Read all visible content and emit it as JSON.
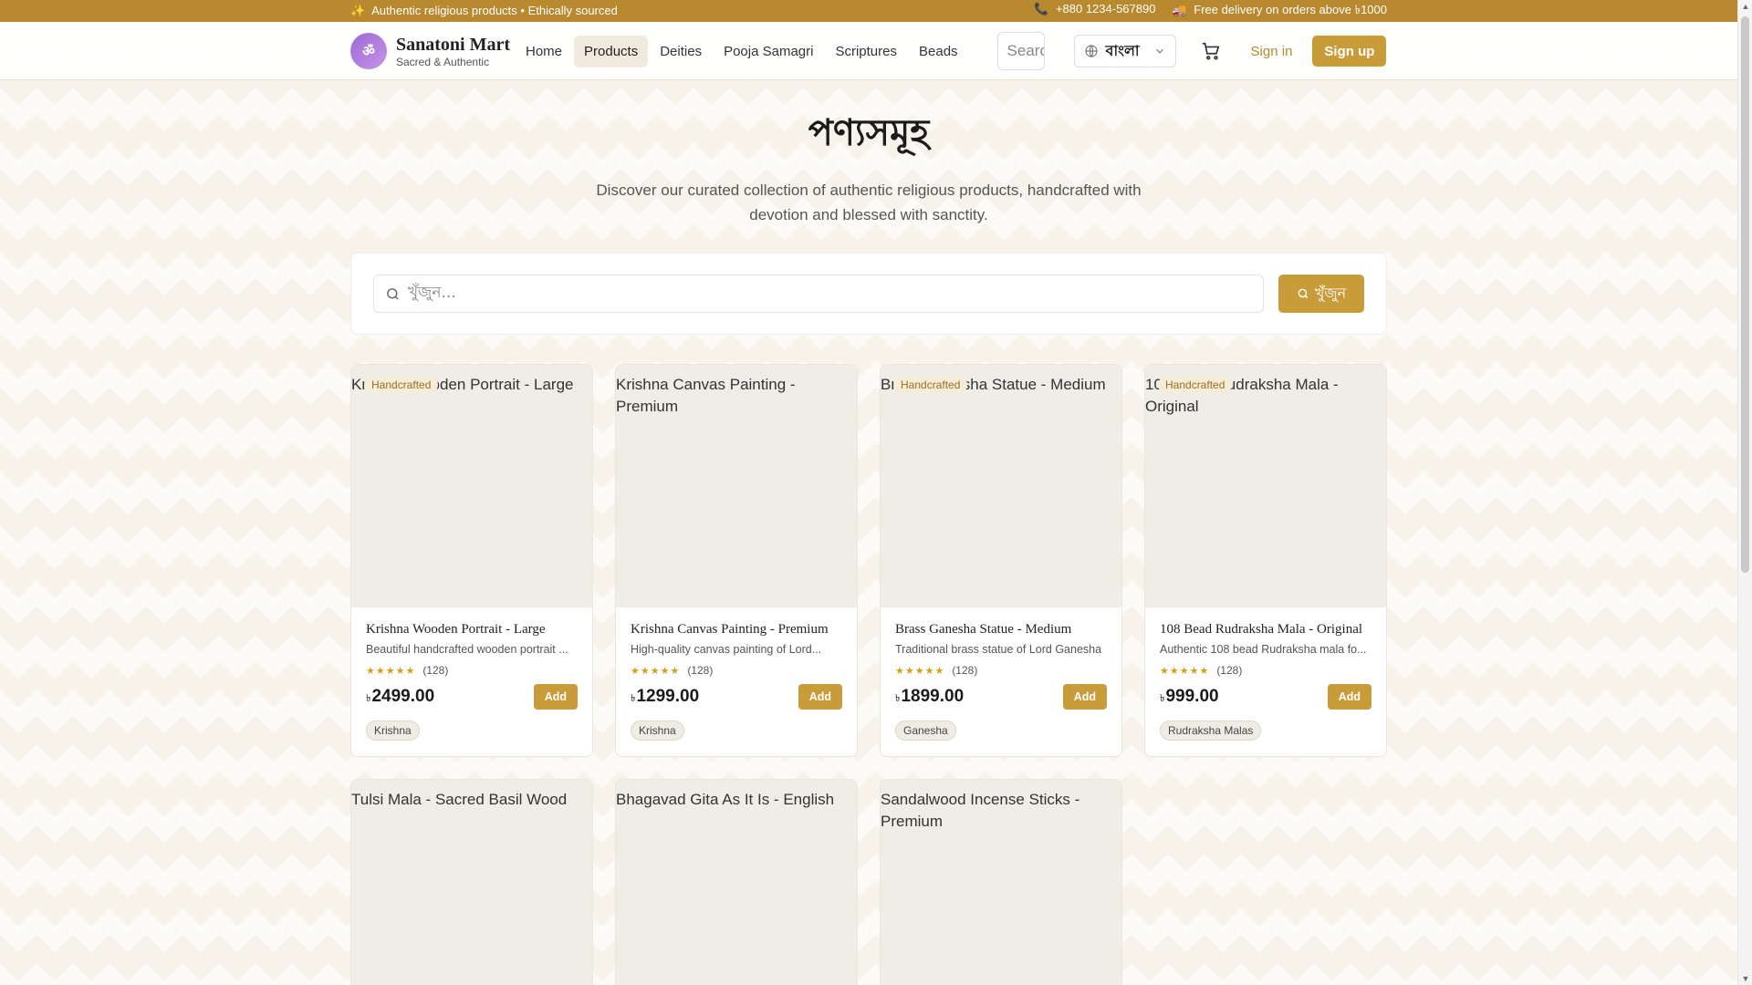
{
  "topbar": {
    "left_icon": "sparkles",
    "left_text": "Authentic religious products • Ethically sourced",
    "phone": "+880 1234-567890",
    "phone_icon": "phone",
    "delivery": "Free delivery on orders above ৳1000",
    "delivery_icon": "truck",
    "color": "#b8892f"
  },
  "brand": {
    "logo_glyph": "ॐ",
    "name": "Sanatoni Mart",
    "tagline": "Sacred & Authentic"
  },
  "nav": {
    "links": [
      "Home",
      "Products",
      "Deities",
      "Pooja Samagri",
      "Scriptures",
      "Beads"
    ],
    "active": "Products",
    "search_placeholder": "Search...",
    "language": "বাংলা",
    "sign_in": "Sign in",
    "sign_up": "Sign up"
  },
  "hero": {
    "title": "পণ্যসমূহ",
    "subtitle": "Discover our curated collection of authentic religious products, handcrafted with devotion and blessed with sanctity."
  },
  "search": {
    "placeholder": "খুঁজুন...",
    "button": "খুঁজুন"
  },
  "colors": {
    "accent": "#c99c3a",
    "accent_dark": "#b8892f"
  },
  "products": [
    {
      "alt": "Krishna Wooden Portrait - Large",
      "badge": "Handcrafted",
      "title": "Krishna Wooden Portrait - Large",
      "desc": "Beautiful handcrafted wooden portrait ...",
      "stars": "★★★★★",
      "reviews": "(128)",
      "currency": "৳",
      "price": "2499.00",
      "add": "Add",
      "category": "Krishna"
    },
    {
      "alt": "Krishna Canvas Painting - Premium",
      "badge": "",
      "title": "Krishna Canvas Painting - Premium",
      "desc": "High-quality canvas painting of Lord...",
      "stars": "★★★★★",
      "reviews": "(128)",
      "currency": "৳",
      "price": "1299.00",
      "add": "Add",
      "category": "Krishna"
    },
    {
      "alt": "Brass Ganesha Statue - Medium",
      "badge": "Handcrafted",
      "title": "Brass Ganesha Statue - Medium",
      "desc": "Traditional brass statue of Lord Ganesha",
      "stars": "★★★★★",
      "reviews": "(128)",
      "currency": "৳",
      "price": "1899.00",
      "add": "Add",
      "category": "Ganesha"
    },
    {
      "alt": "108 Bead Rudraksha Mala - Original",
      "badge": "Handcrafted",
      "title": "108 Bead Rudraksha Mala - Original",
      "desc": "Authentic 108 bead Rudraksha mala fo...",
      "stars": "★★★★★",
      "reviews": "(128)",
      "currency": "৳",
      "price": "999.00",
      "add": "Add",
      "category": "Rudraksha Malas"
    },
    {
      "alt": "Tulsi Mala - Sacred Basil Wood"
    },
    {
      "alt": "Bhagavad Gita As It Is - English"
    },
    {
      "alt": "Sandalwood Incense Sticks - Premium"
    }
  ]
}
